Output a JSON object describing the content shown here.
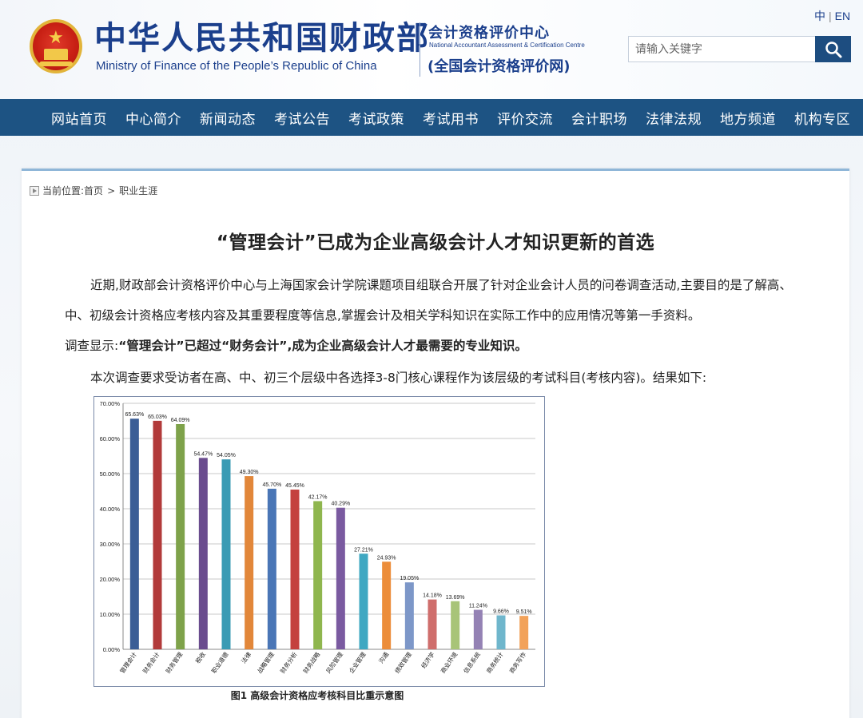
{
  "header": {
    "title_cn": "中华人民共和国财政部",
    "title_en": "Ministry of Finance of the People’s Republic of China",
    "center_cn": "会计资格评价中心",
    "center_en": "National Accountant Assessment & Certification Centre",
    "center_sub": "(全国会计资格评价网)",
    "lang_cn": "中",
    "lang_sep": "|",
    "lang_en": "EN",
    "search_placeholder": "请输入关键字"
  },
  "nav": {
    "items": [
      "网站首页",
      "中心简介",
      "新闻动态",
      "考试公告",
      "考试政策",
      "考试用书",
      "评价交流",
      "会计职场",
      "法律法规",
      "地方频道",
      "机构专区"
    ]
  },
  "breadcrumb": {
    "prefix": "当前位置:",
    "home": "首页",
    "sep": ">",
    "current": "职业生涯"
  },
  "article": {
    "title": "“管理会计”已成为企业高级会计人才知识更新的首选",
    "p1": "近期,财政部会计资格评价中心与上海国家会计学院课题项目组联合开展了针对企业会计人员的问卷调查活动,主要目的是了解高、中、初级会计资格应考核内容及其重要程度等信息,掌握会计及相关学科知识在实际工作中的应用情况等第一手资料。",
    "p2_prefix": "调查显示:",
    "p2_bold": "“管理会计”已超过“财务会计”,成为企业高级会计人才最需要的专业知识。",
    "p3": "本次调查要求受访者在高、中、初三个层级中各选择3-8门核心课程作为该层级的考试科目(考核内容)。结果如下:",
    "chart_caption": "图1 高级会计资格应考核科目比重示意图"
  },
  "chart_data": {
    "type": "bar",
    "categories": [
      "管理会计",
      "财务会计",
      "财务管理",
      "税收",
      "职业道德",
      "法律",
      "战略管理",
      "财务分析",
      "财务战略",
      "风险管理",
      "企业管理",
      "沟通",
      "绩效管理",
      "经济学",
      "商业环境",
      "信息系统",
      "商务统计",
      "商务写作"
    ],
    "values": [
      65.63,
      65.03,
      64.09,
      54.47,
      54.05,
      49.3,
      45.7,
      45.45,
      42.17,
      40.29,
      27.21,
      24.93,
      19.05,
      14.18,
      13.69,
      11.24,
      9.66,
      9.51
    ],
    "value_labels": [
      "65.63%",
      "65.03%",
      "64.09%",
      "54.47%",
      "54.05%",
      "49.30%",
      "45.70%",
      "45.45%",
      "42.17%",
      "40.29%",
      "27.21%",
      "24.93%",
      "19.05%",
      "14.18%",
      "13.69%",
      "11.24%",
      "9.66%",
      "9.51%"
    ],
    "colors": [
      "#3b5e96",
      "#b23a3a",
      "#7ea24a",
      "#6a4c8e",
      "#3a9bb4",
      "#e2873a",
      "#4a76b6",
      "#c4413e",
      "#8fb64e",
      "#7a5aa0",
      "#3fa8c2",
      "#ec8d3a",
      "#7d97c8",
      "#cf6e6c",
      "#a8c478",
      "#9482b4",
      "#6fb6cc",
      "#f2a25a"
    ],
    "ylim": [
      0,
      70
    ],
    "yticks": [
      "0.00%",
      "10.00%",
      "20.00%",
      "30.00%",
      "40.00%",
      "50.00%",
      "60.00%",
      "70.00%"
    ],
    "grid": true,
    "title": "",
    "xlabel": "",
    "ylabel": ""
  },
  "colors": {
    "nav_bg": "#1d5383",
    "brand": "#1b3f8c",
    "panel_border": "#8fb6d8"
  }
}
